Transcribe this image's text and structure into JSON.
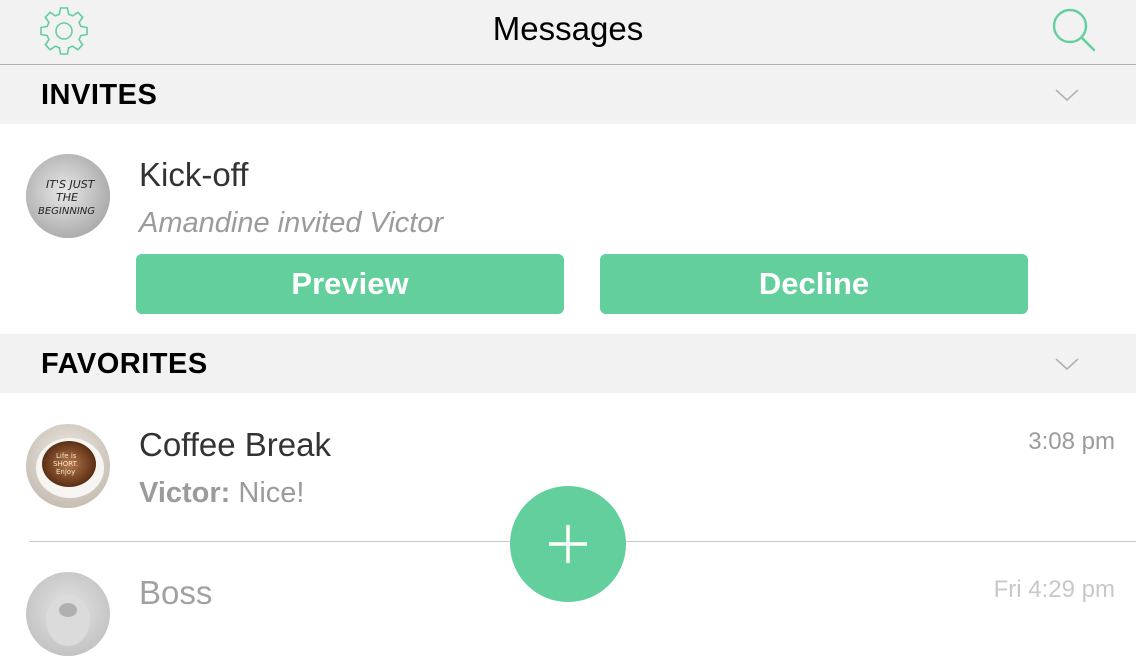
{
  "colors": {
    "accent": "#62cf9c",
    "header_bg": "#f2f2f2",
    "secondary_text": "#9b9b9b"
  },
  "navbar": {
    "title": "Messages",
    "left_icon": "gear-icon",
    "right_icon": "search-icon"
  },
  "sections": {
    "invites": {
      "title": "INVITES",
      "chevron_icon": "chevron-down-icon",
      "rooms": [
        {
          "name": "Kick-off",
          "subtitle": "Amandine invited Victor",
          "avatar_text": [
            "IT'S JUST",
            "THE",
            "BEGINNING"
          ],
          "preview_label": "Preview",
          "decline_label": "Decline"
        }
      ]
    },
    "favorites": {
      "title": "FAVORITES",
      "chevron_icon": "chevron-down-icon",
      "rooms": [
        {
          "name": "Coffee Break",
          "sender": "Victor:",
          "message": "Nice!",
          "time": "3:08 pm",
          "avatar_text": [
            "Life is",
            "SHORT.",
            "Enjoy"
          ]
        },
        {
          "name": "Boss",
          "sender": "",
          "message": "",
          "time": "Fri 4:29 pm"
        }
      ]
    }
  },
  "fab": {
    "icon": "plus-icon"
  }
}
